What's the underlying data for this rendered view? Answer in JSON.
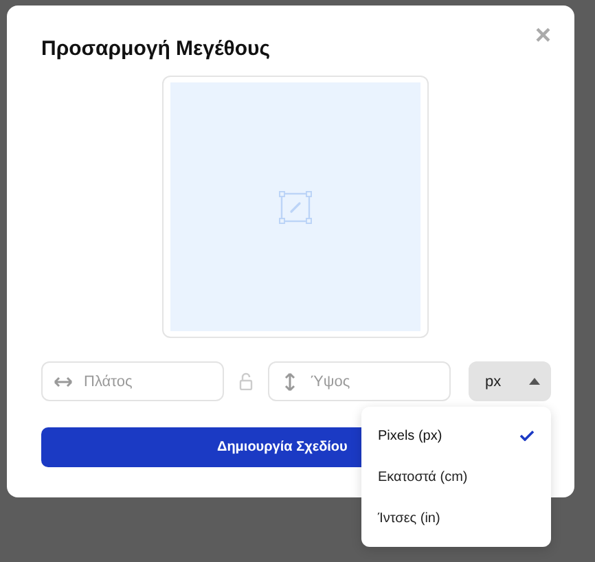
{
  "dialog": {
    "title": "Προσαρμογή Μεγέθους",
    "close": "×"
  },
  "width_field": {
    "placeholder": "Πλάτος"
  },
  "height_field": {
    "placeholder": "Ύψος"
  },
  "unit_select": {
    "value": "px",
    "expanded": true,
    "options": [
      {
        "label": "Pixels (px)",
        "selected": true
      },
      {
        "label": "Εκατοστά (cm)",
        "selected": false
      },
      {
        "label": "Ίντσες (in)",
        "selected": false
      }
    ]
  },
  "create_button": {
    "label": "Δημιουργία Σχεδίου"
  }
}
